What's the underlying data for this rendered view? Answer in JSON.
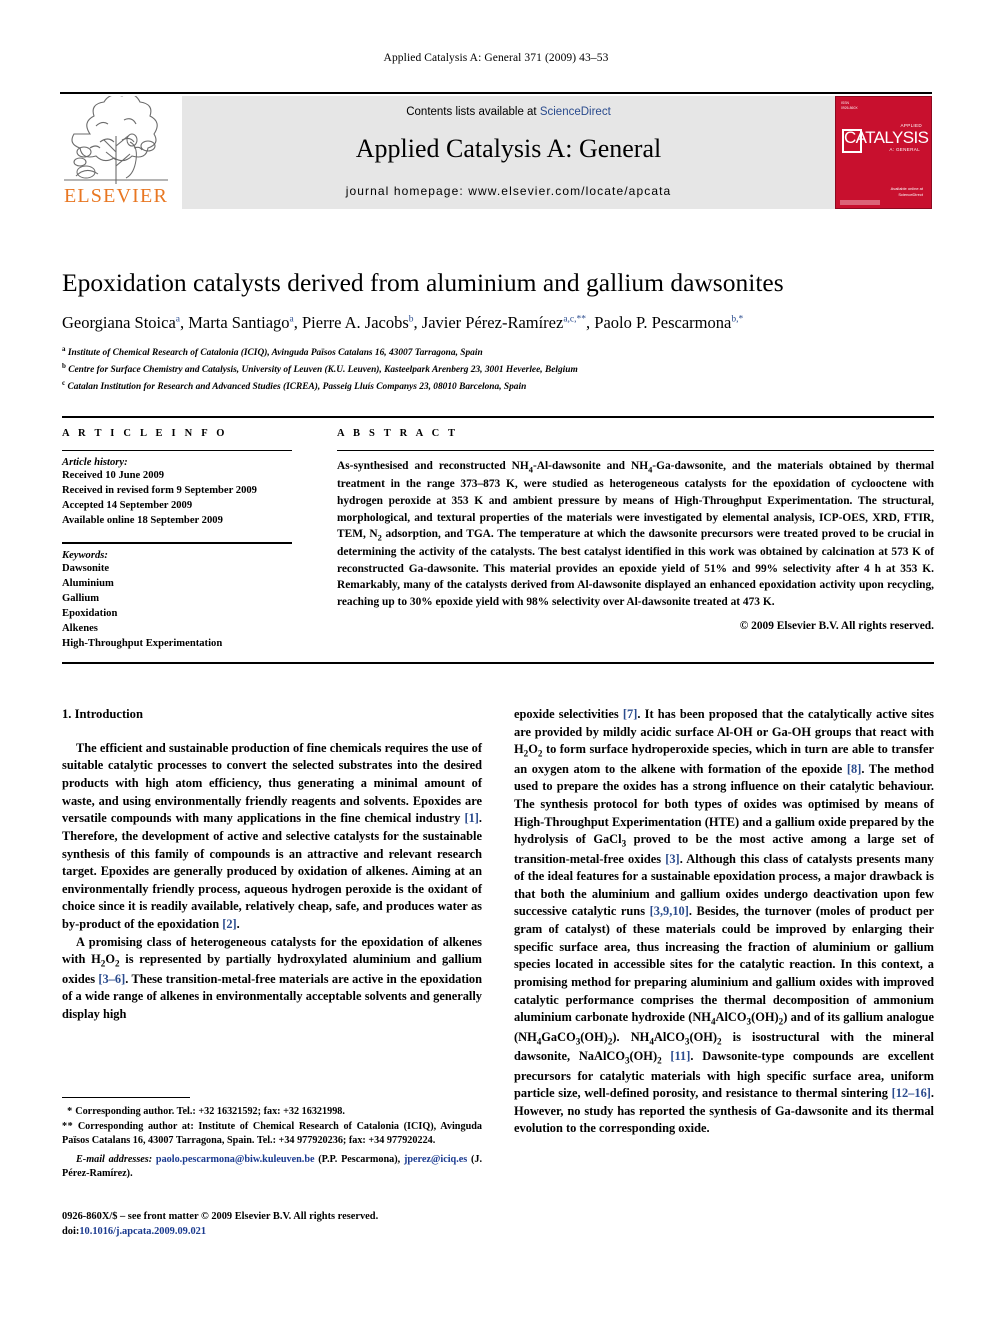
{
  "running_head": "Applied Catalysis A: General 371 (2009) 43–53",
  "masthead": {
    "contents_prefix": "Contents lists available at ",
    "sciencedirect": "ScienceDirect",
    "journal_name": "Applied Catalysis A: General",
    "homepage": "journal homepage: www.elsevier.com/locate/apcata",
    "publisher_wordmark": "ELSEVIER",
    "cover": {
      "issn_block": "ISSN\n0926-860X",
      "sub_top": "APPLIED",
      "title": "CATALYSIS",
      "sub_bottom": "A: GENERAL",
      "bottom_logo": "Available online at\nScienceDirect"
    },
    "accent_orange": "#E87722",
    "cover_red": "#c8102e",
    "link_blue": "#2a4b8d"
  },
  "article": {
    "title": "Epoxidation catalysts derived from aluminium and gallium dawsonites",
    "authors": [
      {
        "name": "Georgiana Stoica",
        "marks": "a"
      },
      {
        "name": "Marta Santiago",
        "marks": "a"
      },
      {
        "name": "Pierre A. Jacobs",
        "marks": "b"
      },
      {
        "name": "Javier Pérez-Ramírez",
        "marks": "a,c,**"
      },
      {
        "name": "Paolo P. Pescarmona",
        "marks": "b,*"
      }
    ],
    "affiliations": [
      {
        "mark": "a",
        "text": "Institute of Chemical Research of Catalonia (ICIQ), Avinguda Països Catalans 16, 43007 Tarragona, Spain"
      },
      {
        "mark": "b",
        "text": "Centre for Surface Chemistry and Catalysis, University of Leuven (K.U. Leuven), Kasteelpark Arenberg 23, 3001 Heverlee, Belgium"
      },
      {
        "mark": "c",
        "text": "Catalan Institution for Research and Advanced Studies (ICREA), Passeig Lluís Companys 23, 08010 Barcelona, Spain"
      }
    ]
  },
  "article_info": {
    "heading": "A R T I C L E   I N F O",
    "history_label": "Article history:",
    "history": [
      "Received 10 June 2009",
      "Received in revised form 9 September 2009",
      "Accepted 14 September 2009",
      "Available online 18 September 2009"
    ],
    "keywords_label": "Keywords:",
    "keywords": [
      "Dawsonite",
      "Aluminium",
      "Gallium",
      "Epoxidation",
      "Alkenes",
      "High-Throughput Experimentation"
    ]
  },
  "abstract": {
    "heading": "A B S T R A C T",
    "paragraph_1": "As-synthesised and reconstructed NH",
    "copyright": "© 2009 Elsevier B.V. All rights reserved."
  },
  "body": {
    "section_number_title": "1. Introduction",
    "left_paragraph_1": "The efficient and sustainable production of fine chemicals requires the use of suitable catalytic processes to convert the selected substrates into the desired products with high atom efficiency, thus generating a minimal amount of waste, and using environmentally friendly reagents and solvents. Epoxides are versatile compounds with many applications in the fine chemical industry",
    "left_paragraph_1_cont": ". Therefore, the development of active and selective catalysts for the sustainable synthesis of this family of compounds is an attractive and relevant research target. Epoxides are generally produced by oxidation of alkenes. Aiming at an environmentally friendly process, aqueous hydrogen peroxide is the oxidant of choice since it is readily available, relatively cheap, safe, and produces water as by-product of the epoxidation",
    "right_paragraph_head": "epoxide selectivities",
    "refs": {
      "r1": "[1]",
      "r2": "[2]",
      "r3_6": "[3–6]",
      "r7": "[7]",
      "r8": "[8]",
      "r3": "[3]",
      "r3_9_10": "[3,9,10]",
      "r11": "[11]",
      "r12_16": "[12–16]"
    }
  },
  "footnotes": {
    "corr_1": "Corresponding author. Tel.: +32 16321592; fax: +32 16321998.",
    "corr_2": "Corresponding author at: Institute of Chemical Research of Catalonia (ICIQ), Avinguda Països Catalans 16, 43007 Tarragona, Spain. Tel.: +34 977920236; fax: +34 977920224.",
    "email_label": "E-mail addresses:",
    "email_1": "paolo.pescarmona@biw.kuleuven.be",
    "email_1_owner": "(P.P. Pescarmona)",
    "email_2": "jperez@iciq.es",
    "email_2_owner": "(J. Pérez-Ramírez)"
  },
  "imprint": {
    "front_matter": "0926-860X/$ – see front matter © 2009 Elsevier B.V. All rights reserved.",
    "doi_label": "doi:",
    "doi": "10.1016/j.apcata.2009.09.021"
  }
}
